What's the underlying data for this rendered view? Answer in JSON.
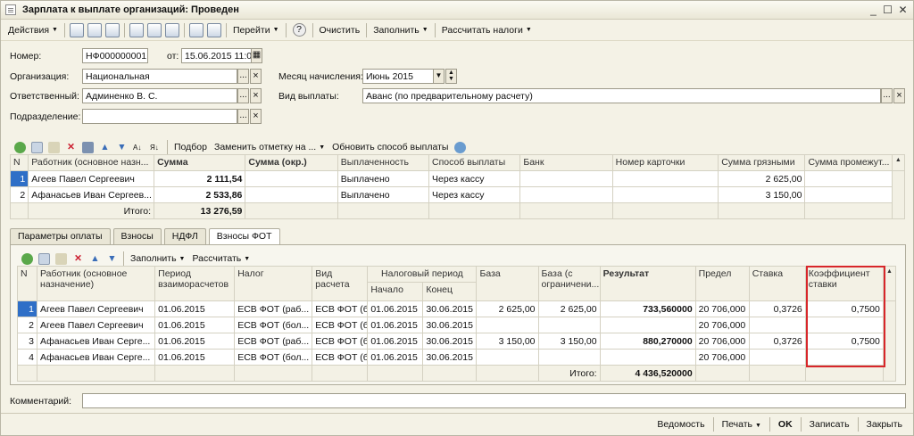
{
  "window": {
    "title": "Зарплата к выплате организаций: Проведен",
    "icons": [
      "minimize-icon",
      "maximize-icon",
      "close-icon"
    ]
  },
  "toolbar": {
    "actions": "Действия",
    "goto": "Перейти",
    "help": "?",
    "clear": "Очистить",
    "fill": "Заполнить",
    "calc_taxes": "Рассчитать налоги"
  },
  "form": {
    "number_label": "Номер:",
    "number_value": "НФ000000001",
    "date_label": "от:",
    "date_value": "15.06.2015 11:0",
    "org_label": "Организация:",
    "org_value": "Национальная",
    "resp_label": "Ответственный:",
    "resp_value": "Админенко В. С.",
    "dept_label": "Подразделение:",
    "dept_value": "",
    "month_label": "Месяц начисления:",
    "month_value": "Июнь 2015",
    "paytype_label": "Вид выплаты:",
    "paytype_value": "Аванс (по предварительному расчету)",
    "ellipsis": "...",
    "clear_x": "×"
  },
  "grid1_toolbar": {
    "select": "Подбор",
    "replace_mark": "Заменить отметку на ...",
    "update_method": "Обновить способ выплаты"
  },
  "grid1": {
    "headers": [
      "N",
      "Работник (основное назн...",
      "Сумма",
      "Сумма (окр.)",
      "Выплаченность",
      "Способ выплаты",
      "Банк",
      "Номер карточки",
      "Сумма грязными",
      "Сумма промежут..."
    ],
    "rows": [
      [
        "1",
        "Агеев Павел Сергеевич",
        "2 111,54",
        "",
        "Выплачено",
        "Через кассу",
        "",
        "",
        "2 625,00",
        ""
      ],
      [
        "2",
        "Афанасьев Иван Сергеев...",
        "2 533,86",
        "",
        "Выплачено",
        "Через кассу",
        "",
        "",
        "3 150,00",
        ""
      ]
    ],
    "total_label": "Итого:",
    "total_value": "13 276,59"
  },
  "tabs": [
    "Параметры оплаты",
    "Взносы",
    "НДФЛ",
    "Взносы ФОТ"
  ],
  "grid2_toolbar": {
    "fill": "Заполнить",
    "calc": "Рассчитать"
  },
  "grid2": {
    "headers": {
      "n": "N",
      "worker": "Работник (основное назначение)",
      "period": "Период взаиморасчетов",
      "tax": "Налог",
      "calc_type": "Вид расчета",
      "tax_period": "Налоговый период",
      "start": "Начало",
      "end": "Конец",
      "base": "База",
      "base_limit": "База (с ограничени...",
      "result": "Результат",
      "limit": "Предел",
      "rate": "Ставка",
      "coef": "Коэффициент ставки"
    },
    "rows": [
      [
        "1",
        "Агеев Павел Сергеевич",
        "01.06.2015",
        "ЕСВ ФОТ (раб...",
        "ЕСВ ФОТ (бол...",
        "01.06.2015",
        "30.06.2015",
        "2 625,00",
        "2 625,00",
        "733,560000",
        "20 706,000",
        "0,3726",
        "0,7500"
      ],
      [
        "2",
        "Агеев Павел Сергеевич",
        "01.06.2015",
        "ЕСВ ФОТ (бол...",
        "ЕСВ ФОТ (бол...",
        "01.06.2015",
        "30.06.2015",
        "",
        "",
        "",
        "20 706,000",
        "",
        ""
      ],
      [
        "3",
        "Афанасьев Иван Серге...",
        "01.06.2015",
        "ЕСВ ФОТ (раб...",
        "ЕСВ ФОТ (бол...",
        "01.06.2015",
        "30.06.2015",
        "3 150,00",
        "3 150,00",
        "880,270000",
        "20 706,000",
        "0,3726",
        "0,7500"
      ],
      [
        "4",
        "Афанасьев Иван Серге...",
        "01.06.2015",
        "ЕСВ ФОТ (бол...",
        "ЕСВ ФОТ (бол...",
        "01.06.2015",
        "30.06.2015",
        "",
        "",
        "",
        "20 706,000",
        "",
        ""
      ]
    ],
    "total_label": "Итого:",
    "total_value": "4 436,520000"
  },
  "comment": {
    "label": "Комментарий:",
    "value": ""
  },
  "bottom": {
    "report": "Ведомость",
    "print": "Печать",
    "ok": "OK",
    "save": "Записать",
    "close": "Закрыть"
  },
  "colors": {
    "selection": "#2f6fc7",
    "highlight_box": "#d8262a",
    "background": "#f4f2e6"
  }
}
